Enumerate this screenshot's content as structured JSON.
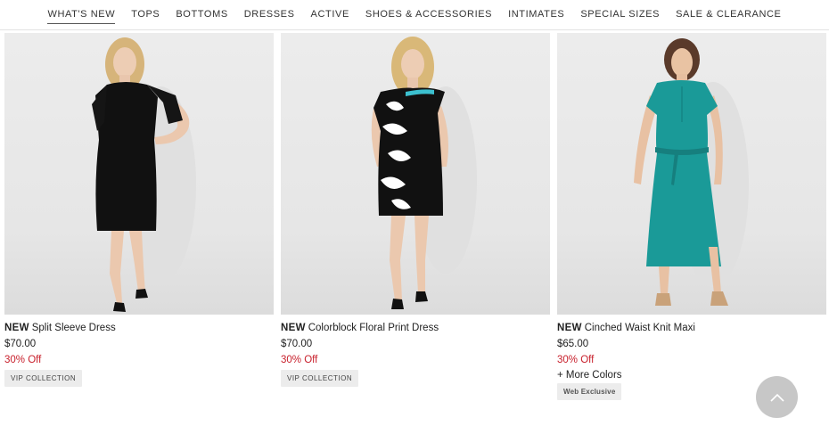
{
  "nav": {
    "items": [
      {
        "label": "WHAT'S NEW"
      },
      {
        "label": "TOPS"
      },
      {
        "label": "BOTTOMS"
      },
      {
        "label": "DRESSES"
      },
      {
        "label": "ACTIVE"
      },
      {
        "label": "SHOES & ACCESSORIES"
      },
      {
        "label": "INTIMATES"
      },
      {
        "label": "SPECIAL SIZES"
      },
      {
        "label": "SALE & CLEARANCE"
      }
    ]
  },
  "products": [
    {
      "new_tag": "NEW",
      "name": "Split Sleeve Dress",
      "price": "$70.00",
      "discount": "30% Off",
      "badge": "VIP COLLECTION"
    },
    {
      "new_tag": "NEW",
      "name": "Colorblock Floral Print Dress",
      "price": "$70.00",
      "discount": "30% Off",
      "badge": "VIP COLLECTION"
    },
    {
      "new_tag": "NEW",
      "name": "Cinched Waist Knit Maxi",
      "price": "$65.00",
      "discount": "30% Off",
      "more_colors": "+ More Colors",
      "badge": "Web Exclusive"
    }
  ],
  "colors": {
    "discount_red": "#c8202c",
    "teal_dress": "#1a9a98",
    "photo_bg": "#e8e8e8"
  },
  "back_to_top": {
    "icon": "chevron-up-icon"
  }
}
